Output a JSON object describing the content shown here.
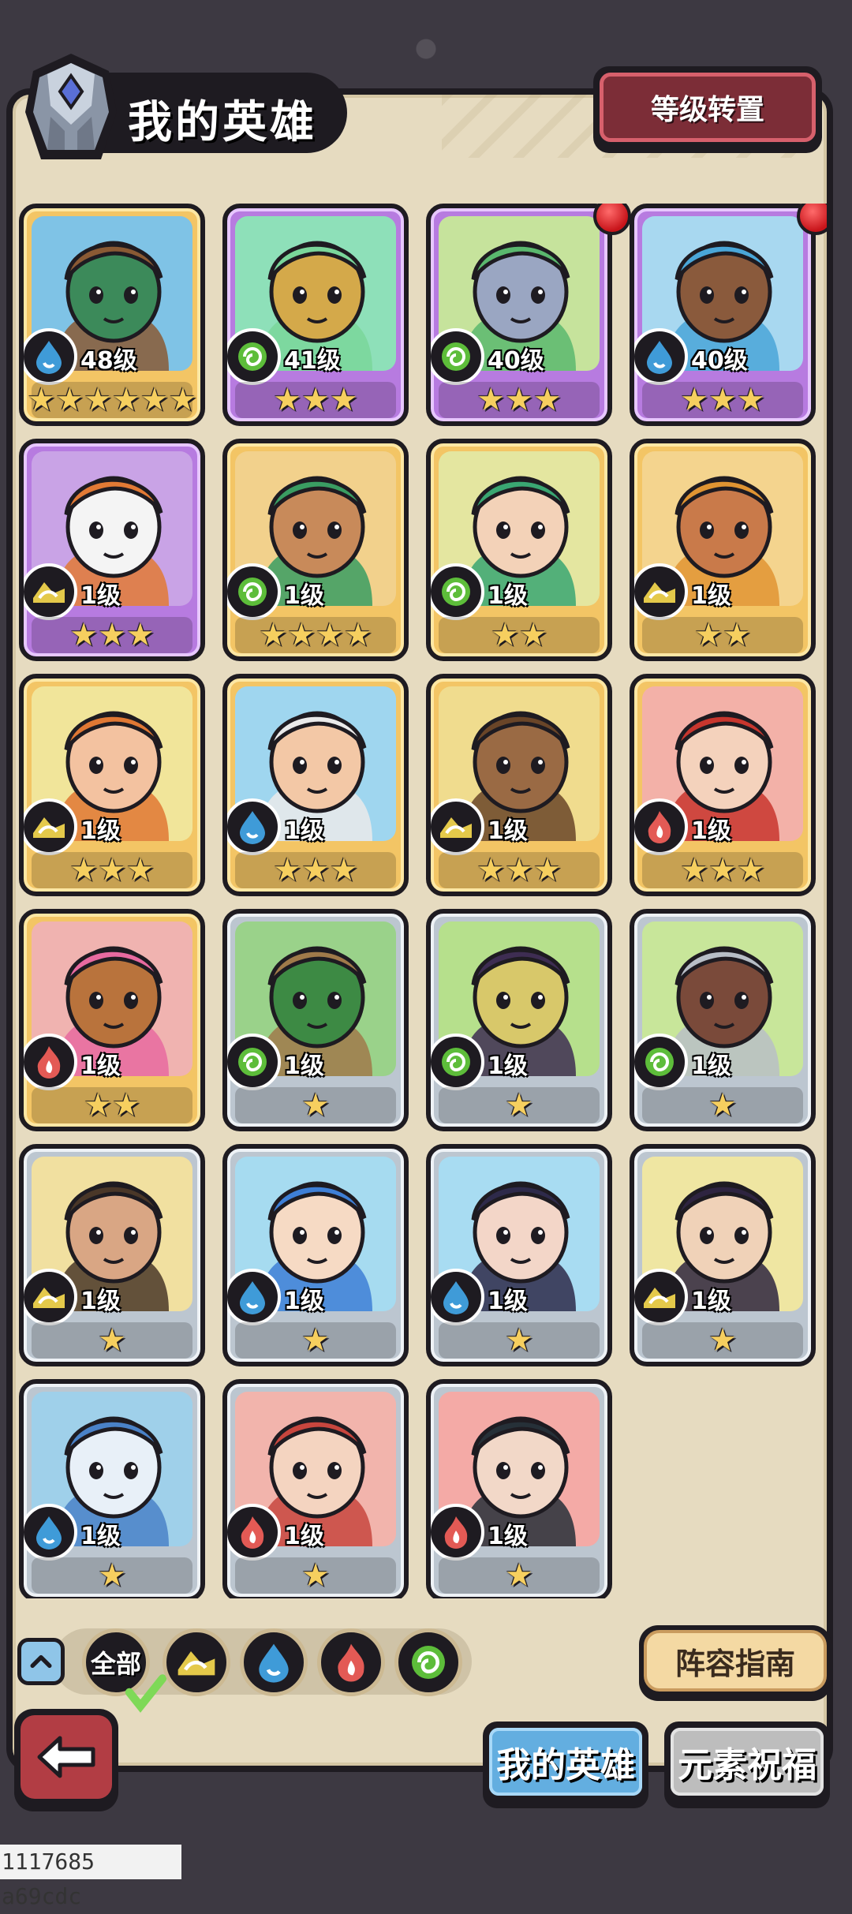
{
  "header": {
    "title": "我的英雄",
    "transfer_button": "等级转置"
  },
  "heroes": [
    {
      "level": "48级",
      "element": "water",
      "stars": 6,
      "frame": "gold",
      "dot": false,
      "palette": [
        "#7fc3e6",
        "#8a5a34",
        "#3c8a5a"
      ]
    },
    {
      "level": "41级",
      "element": "wind",
      "stars": 3,
      "frame": "purple",
      "dot": false,
      "palette": [
        "#8ee0b9",
        "#7ad69a",
        "#d4a94a"
      ]
    },
    {
      "level": "40级",
      "element": "wind",
      "stars": 3,
      "frame": "purple",
      "dot": true,
      "palette": [
        "#c6e39c",
        "#5ab86e",
        "#9aa6c2"
      ]
    },
    {
      "level": "40级",
      "element": "water",
      "stars": 3,
      "frame": "purple",
      "dot": true,
      "palette": [
        "#a8d8f0",
        "#4aa6d8",
        "#8a5a3c"
      ]
    },
    {
      "level": "1级",
      "element": "earth",
      "stars": 3,
      "frame": "purple",
      "dot": false,
      "palette": [
        "#c9a3e6",
        "#e27a35",
        "#f4f4f4"
      ]
    },
    {
      "level": "1级",
      "element": "wind",
      "stars": 4,
      "frame": "gold",
      "dot": false,
      "palette": [
        "#f2d18c",
        "#3a9d62",
        "#c88a5a"
      ]
    },
    {
      "level": "1级",
      "element": "wind",
      "stars": 2,
      "frame": "gold",
      "dot": false,
      "palette": [
        "#e4e6a0",
        "#3aa672",
        "#f3d2b8"
      ]
    },
    {
      "level": "1级",
      "element": "earth",
      "stars": 2,
      "frame": "gold",
      "dot": false,
      "palette": [
        "#f4d48e",
        "#e09432",
        "#c97a4a"
      ]
    },
    {
      "level": "1级",
      "element": "earth",
      "stars": 3,
      "frame": "gold",
      "dot": false,
      "palette": [
        "#f1e59a",
        "#e07834",
        "#f3c2a0"
      ]
    },
    {
      "level": "1级",
      "element": "water",
      "stars": 3,
      "frame": "gold",
      "dot": false,
      "palette": [
        "#9fd6ef",
        "#eaeaea",
        "#f3c8a6"
      ]
    },
    {
      "level": "1级",
      "element": "earth",
      "stars": 3,
      "frame": "gold",
      "dot": false,
      "palette": [
        "#f0dc8e",
        "#6a4528",
        "#9a6a44"
      ]
    },
    {
      "level": "1级",
      "element": "fire",
      "stars": 3,
      "frame": "gold",
      "dot": false,
      "palette": [
        "#f3b1a8",
        "#c8362e",
        "#f4d2bc"
      ]
    },
    {
      "level": "1级",
      "element": "fire",
      "stars": 2,
      "frame": "gold",
      "dot": false,
      "palette": [
        "#f0b3b0",
        "#e86aa0",
        "#b9733c"
      ]
    },
    {
      "level": "1级",
      "element": "wind",
      "stars": 1,
      "frame": "silver",
      "dot": false,
      "palette": [
        "#9ad28a",
        "#a07a4a",
        "#3d8a44"
      ]
    },
    {
      "level": "1级",
      "element": "wind",
      "stars": 1,
      "frame": "silver",
      "dot": false,
      "palette": [
        "#b6e08c",
        "#3e2d52",
        "#d8c86a"
      ]
    },
    {
      "level": "1级",
      "element": "wind",
      "stars": 1,
      "frame": "silver",
      "dot": false,
      "palette": [
        "#c8e69a",
        "#b8bec6",
        "#7a4a3a"
      ]
    },
    {
      "level": "1级",
      "element": "earth",
      "stars": 1,
      "frame": "silver",
      "dot": false,
      "palette": [
        "#f1e0a0",
        "#4a3728",
        "#d9a684"
      ]
    },
    {
      "level": "1级",
      "element": "water",
      "stars": 1,
      "frame": "silver",
      "dot": false,
      "palette": [
        "#a6dbf0",
        "#3e7fd6",
        "#f6dac4"
      ]
    },
    {
      "level": "1级",
      "element": "water",
      "stars": 1,
      "frame": "silver",
      "dot": false,
      "palette": [
        "#a8dcf2",
        "#2e2a4a",
        "#f3d6c8"
      ]
    },
    {
      "level": "1级",
      "element": "earth",
      "stars": 1,
      "frame": "silver",
      "dot": false,
      "palette": [
        "#efe6a2",
        "#2e2440",
        "#f0d2b8"
      ]
    },
    {
      "level": "1级",
      "element": "water",
      "stars": 1,
      "frame": "silver",
      "dot": false,
      "palette": [
        "#9fd0ea",
        "#4a82c8",
        "#e8f0f8"
      ]
    },
    {
      "level": "1级",
      "element": "fire",
      "stars": 1,
      "frame": "silver",
      "dot": false,
      "palette": [
        "#f2b4ac",
        "#c8463e",
        "#f4d4c0"
      ]
    },
    {
      "level": "1级",
      "element": "fire",
      "stars": 1,
      "frame": "silver",
      "dot": false,
      "palette": [
        "#f4aaa6",
        "#263038",
        "#f2d8c8"
      ]
    }
  ],
  "filters": {
    "all_label": "全部",
    "items": [
      "earth",
      "water",
      "fire",
      "wind"
    ]
  },
  "guide_button": "阵容指南",
  "tabs": {
    "my_heroes": "我的英雄",
    "blessing": "元素祝福"
  },
  "debug": "1117685 a69cdc",
  "colors": {
    "water": "#3f9bd8",
    "wind": "#5dbd3a",
    "earth": "#e4c94a",
    "fire": "#e35a55"
  }
}
